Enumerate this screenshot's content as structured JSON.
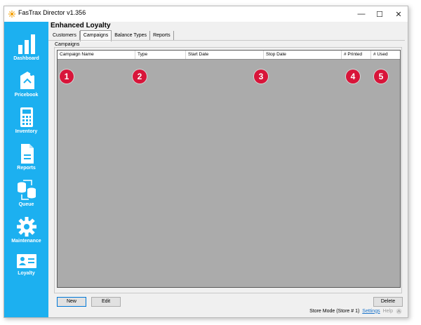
{
  "window": {
    "title": "FasTrax Director v1.356",
    "controls": {
      "minimize": "—",
      "maximize": "☐",
      "close": "✕"
    }
  },
  "sidebar": {
    "items": [
      {
        "label": "Dashboard",
        "icon": "bar-chart-icon"
      },
      {
        "label": "Pricebook",
        "icon": "price-tag-icon"
      },
      {
        "label": "Inventory",
        "icon": "calculator-icon"
      },
      {
        "label": "Reports",
        "icon": "report-document-icon"
      },
      {
        "label": "Queue",
        "icon": "database-sync-icon"
      },
      {
        "label": "Maintenance",
        "icon": "gear-icon"
      },
      {
        "label": "Loyalty",
        "icon": "id-card-icon"
      }
    ],
    "color": "#1cb0f0"
  },
  "main": {
    "heading": "Enhanced Loyalty",
    "tabs": [
      {
        "label": "Customers",
        "active": false
      },
      {
        "label": "Campaigns",
        "active": true
      },
      {
        "label": "Balance Types",
        "active": false
      },
      {
        "label": "Reports",
        "active": false
      }
    ],
    "group_label": "Campaigns",
    "table": {
      "columns": [
        "Campaign Name",
        "Type",
        "Start Date",
        "Stop Date",
        "# Printed",
        "# Used"
      ],
      "rows": []
    },
    "markers": [
      "1",
      "2",
      "3",
      "4",
      "5"
    ],
    "marker_color": "#d8153a",
    "buttons": {
      "new": "New",
      "edit": "Edit",
      "delete": "Delete"
    }
  },
  "status": {
    "mode": "Store Mode (Store # 1)",
    "settings": "Settings",
    "help": "Help"
  }
}
